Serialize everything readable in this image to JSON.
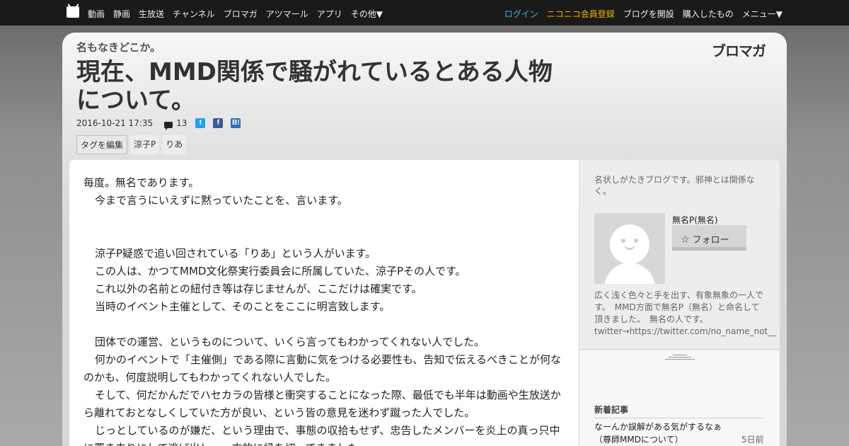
{
  "topnav": {
    "left": [
      "動画",
      "静画",
      "生放送",
      "チャンネル",
      "ブロマガ",
      "アツマール",
      "アプリ",
      "その他▼"
    ],
    "right": [
      "ログイン",
      "ニコニコ会員登録",
      "ブログを開設",
      "購入したもの",
      "メニュー▼"
    ]
  },
  "blog": {
    "name": "名もなきどこか。",
    "service_logo": "ブロマガ"
  },
  "article": {
    "title": "現在、MMD関係で騒がれているとある人物について。",
    "date": "2016-10-21 17:35",
    "comment_count": "13",
    "share": {
      "twitter": "t",
      "facebook": "f",
      "hatena": "B!"
    },
    "tag_edit": "タグを編集",
    "tags": [
      "涼子P",
      "りあ"
    ],
    "paragraphs": [
      "毎度。無名であります。",
      "今まで言うにいえずに黙っていたことを、言います。",
      "",
      "",
      "涼子P疑惑で追い回されている「りあ」という人がいます。",
      "この人は、かつてMMD文化祭実行委員会に所属していた、涼子Pその人です。",
      "これ以外の名前との紐付き等は存じませんが、ここだけは確実です。",
      "当時のイベント主催として、そのことをここに明言致します。",
      "",
      "団体での運営、というものについて、いくら言ってもわかってくれない人でした。",
      "何かのイベントで「主催側」である際に言動に気をつける必要性も、告知で伝えるべきことが何なのかも、何度説明してもわかってくれない人でした。",
      "そして、何だかんだでハセカラの皆様と衝突することになった際、最低でも半年は動画や生放送から離れておとなしくしていた方が良い、という皆の意見を迷わず蹴った人でした。",
      "じっとしているのが嫌だ、という理由で、事態の収拾もせず、忠告したメンバーを炎上の真っ只中に置き去りにして逃げ出し、一方的に縁を切ってきました。"
    ]
  },
  "sidebar": {
    "description": "名状しがたきブログです。邪神とは関係なく。",
    "author_name": "無名P(無名)",
    "follow_label": "フォロー",
    "author_desc": "広く浅く色々と手を出す、有象無象の一人です。　MMD方面で無名P（無名）と命名して頂きました。　無名の人です。 twitter→https://twitter.com/no_name_not__",
    "new_articles_head": "新着記事",
    "new_article_title": "なーんか誤解がある気がするなぁ（尊師MMDについて）",
    "new_article_age": "5日前"
  }
}
